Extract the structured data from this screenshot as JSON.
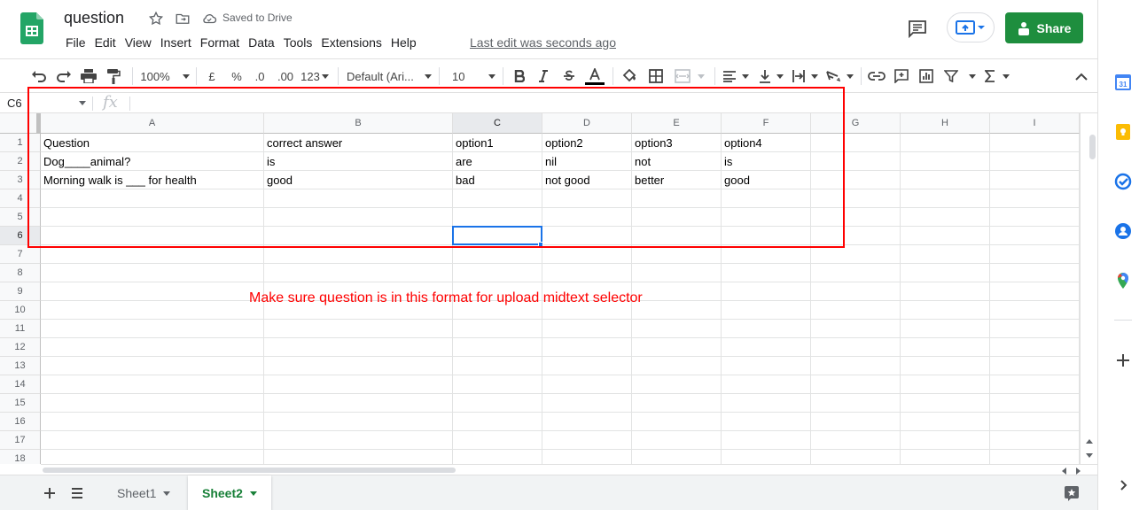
{
  "header": {
    "title": "question",
    "saved_status": "Saved to Drive",
    "last_edit": "Last edit was seconds ago",
    "share_label": "Share"
  },
  "menu": [
    "File",
    "Edit",
    "View",
    "Insert",
    "Format",
    "Data",
    "Tools",
    "Extensions",
    "Help"
  ],
  "toolbar": {
    "zoom": "100%",
    "currency": "£",
    "percent": "%",
    "decrease_decimals": ".0",
    "increase_decimals": ".00",
    "more_formats": "123",
    "font": "Default (Ari...",
    "font_size": "10"
  },
  "formula_bar": {
    "cell_ref": "C6",
    "fx_symbol": "fx",
    "value": ""
  },
  "grid": {
    "columns": [
      "A",
      "B",
      "C",
      "D",
      "E",
      "F",
      "G",
      "H",
      "I"
    ],
    "rows": [
      "1",
      "2",
      "3",
      "4",
      "5",
      "6",
      "7",
      "8",
      "9",
      "10",
      "11",
      "12",
      "13",
      "14",
      "15",
      "16",
      "17",
      "18"
    ],
    "cells": [
      [
        "Question",
        "correct answer",
        "option1",
        "option2",
        "option3",
        "option4"
      ],
      [
        "Dog____animal?",
        "is",
        "are",
        "nil",
        "not",
        "is"
      ],
      [
        "Morning walk is ___ for health",
        "good",
        "bad",
        "not good",
        "better",
        "good"
      ]
    ],
    "active_cell": "C6"
  },
  "annotation": "Make sure question is in this format for upload midtext selector",
  "sheets": {
    "tabs": [
      "Sheet1",
      "Sheet2"
    ],
    "active": "Sheet2"
  },
  "side_panel": {
    "icons": [
      "calendar-icon",
      "keep-icon",
      "tasks-icon",
      "contacts-icon",
      "maps-icon",
      "add-icon",
      "expand-icon"
    ]
  },
  "colors": {
    "share_green": "#1e8e3e",
    "active_tab_green": "#188038",
    "selection_blue": "#1a73e8",
    "highlight_red": "#ff0000"
  }
}
